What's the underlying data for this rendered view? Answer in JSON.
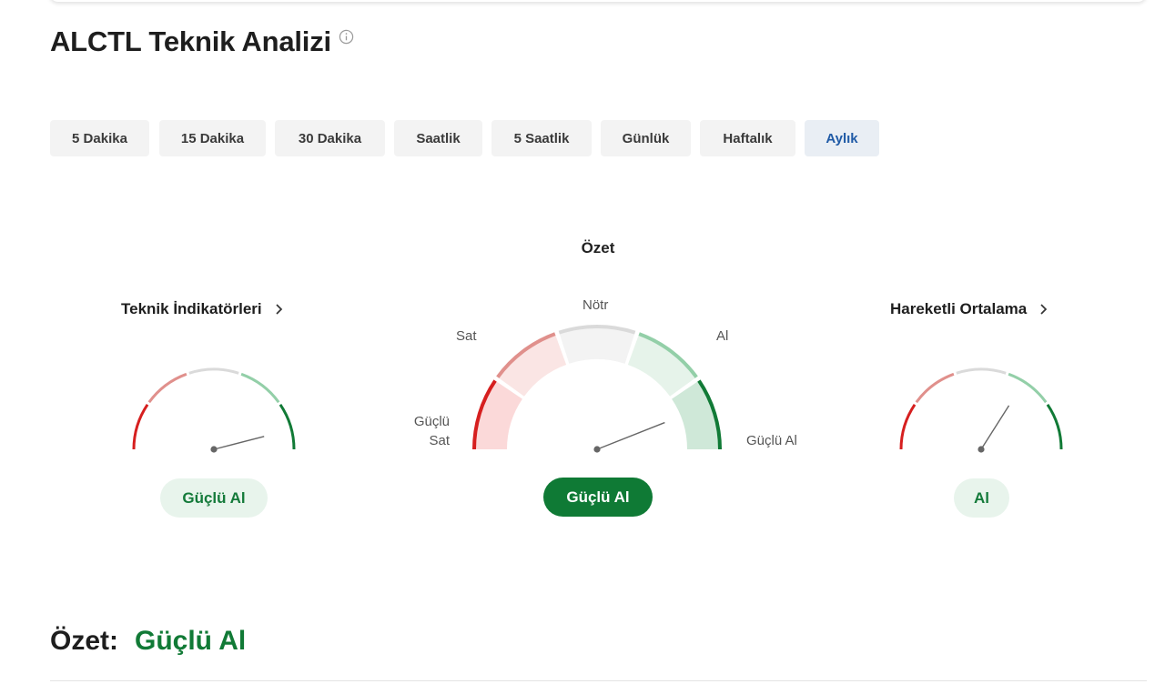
{
  "page": {
    "title": "ALCTL Teknik Analizi",
    "info_icon": "info-circle-icon"
  },
  "timeframes": [
    {
      "label": "5 Dakika",
      "active": false
    },
    {
      "label": "15 Dakika",
      "active": false
    },
    {
      "label": "30 Dakika",
      "active": false
    },
    {
      "label": "Saatlik",
      "active": false
    },
    {
      "label": "5 Saatlik",
      "active": false
    },
    {
      "label": "Günlük",
      "active": false
    },
    {
      "label": "Haftalık",
      "active": false
    },
    {
      "label": "Aylık",
      "active": true
    }
  ],
  "summary": {
    "title": "Özet",
    "scale_labels": {
      "strong_sell": "Güçlü Sat",
      "sell": "Sat",
      "neutral": "Nötr",
      "buy": "Al",
      "strong_buy": "Güçlü Al"
    },
    "result": "Güçlü Al",
    "needle_value": 0.88
  },
  "indicators": {
    "title": "Teknik İndikatörleri",
    "result": "Güçlü Al",
    "needle_value": 0.92,
    "chevron_icon": "chevron-right-icon"
  },
  "moving_averages": {
    "title": "Hareketli Ortalama",
    "result": "Al",
    "needle_value": 0.68,
    "chevron_icon": "chevron-right-icon"
  },
  "bottom_summary": {
    "label": "Özet:",
    "value": "Güçlü Al"
  },
  "colors": {
    "strong_sell": "#d61f1f",
    "sell": "#e0908c",
    "neutral": "#dadada",
    "buy": "#93cfa8",
    "strong_buy": "#117a36",
    "active_tab_text": "#1f5aa6"
  }
}
